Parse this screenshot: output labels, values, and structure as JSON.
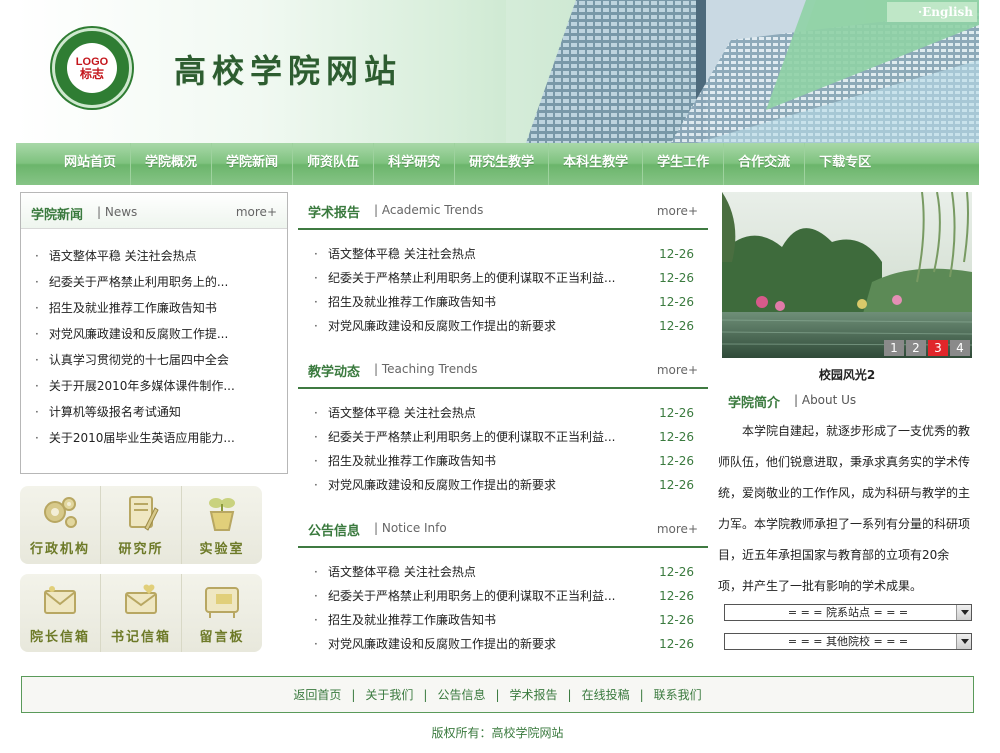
{
  "header": {
    "logo_top": "LOGO",
    "logo_bottom": "标志",
    "site_title": "高校学院网站",
    "english_link": "·English"
  },
  "nav": {
    "items": [
      {
        "label": "网站首页"
      },
      {
        "label": "学院概况"
      },
      {
        "label": "学院新闻"
      },
      {
        "label": "师资队伍"
      },
      {
        "label": "科学研究"
      },
      {
        "label": "研究生教学"
      },
      {
        "label": "本科生教学"
      },
      {
        "label": "学生工作"
      },
      {
        "label": "合作交流"
      },
      {
        "label": "下载专区"
      }
    ]
  },
  "college_news": {
    "title": "学院新闻",
    "subtitle": "| News",
    "more": "more+",
    "items": [
      "语文整体平稳 关注社会热点",
      "纪委关于严格禁止利用职务上的...",
      "招生及就业推荐工作廉政告知书",
      "对党风廉政建设和反腐败工作提...",
      "认真学习贯彻党的十七届四中全会",
      "关于开展2010年多媒体课件制作...",
      "计算机等级报名考试通知",
      "关于2010届毕业生英语应用能力..."
    ]
  },
  "quick_links_1": [
    {
      "label": "行政机构",
      "icon": "gears-icon"
    },
    {
      "label": "研究所",
      "icon": "document-pen-icon"
    },
    {
      "label": "实验室",
      "icon": "plant-pot-icon"
    }
  ],
  "quick_links_2": [
    {
      "label": "院长信箱",
      "icon": "envelope-icon"
    },
    {
      "label": "书记信箱",
      "icon": "envelope-heart-icon"
    },
    {
      "label": "留言板",
      "icon": "message-board-icon"
    }
  ],
  "sections": [
    {
      "title": "学术报告",
      "subtitle": "| Academic Trends",
      "more": "more+",
      "items": [
        {
          "text": "语文整体平稳 关注社会热点",
          "date": "12-26"
        },
        {
          "text": "纪委关于严格禁止利用职务上的便利谋取不正当利益...",
          "date": "12-26"
        },
        {
          "text": "招生及就业推荐工作廉政告知书",
          "date": "12-26"
        },
        {
          "text": "对党风廉政建设和反腐败工作提出的新要求",
          "date": "12-26"
        }
      ]
    },
    {
      "title": "教学动态",
      "subtitle": "| Teaching Trends",
      "more": "more+",
      "items": [
        {
          "text": "语文整体平稳 关注社会热点",
          "date": "12-26"
        },
        {
          "text": "纪委关于严格禁止利用职务上的便利谋取不正当利益...",
          "date": "12-26"
        },
        {
          "text": "招生及就业推荐工作廉政告知书",
          "date": "12-26"
        },
        {
          "text": "对党风廉政建设和反腐败工作提出的新要求",
          "date": "12-26"
        }
      ]
    },
    {
      "title": "公告信息",
      "subtitle": "| Notice Info",
      "more": "more+",
      "items": [
        {
          "text": "语文整体平稳 关注社会热点",
          "date": "12-26"
        },
        {
          "text": "纪委关于严格禁止利用职务上的便利谋取不正当利益...",
          "date": "12-26"
        },
        {
          "text": "招生及就业推荐工作廉政告知书",
          "date": "12-26"
        },
        {
          "text": "对党风廉政建设和反腐败工作提出的新要求",
          "date": "12-26"
        }
      ]
    }
  ],
  "slideshow": {
    "caption": "校园风光2",
    "pages": [
      "1",
      "2",
      "3",
      "4"
    ],
    "active_page": "3"
  },
  "about": {
    "title": "学院简介",
    "subtitle": "| About Us",
    "text": "本学院自建起，就逐步形成了一支优秀的教师队伍，他们锐意进取，秉承求真务实的学术传统，爱岗敬业的工作作风，成为科研与教学的主力军。本学院教师承担了一系列有分量的科研项目，近五年承担国家与教育部的立项有20余项，并产生了一批有影响的学术成果。"
  },
  "selects": {
    "department": "= = = 院系站点 = = =",
    "other": "= = = 其他院校 = = ="
  },
  "footer": {
    "links": [
      "返回首页",
      "关于我们",
      "公告信息",
      "学术报告",
      "在线投稿",
      "联系我们"
    ],
    "separator": "|",
    "copyright": "版权所有：高校学院网站"
  }
}
